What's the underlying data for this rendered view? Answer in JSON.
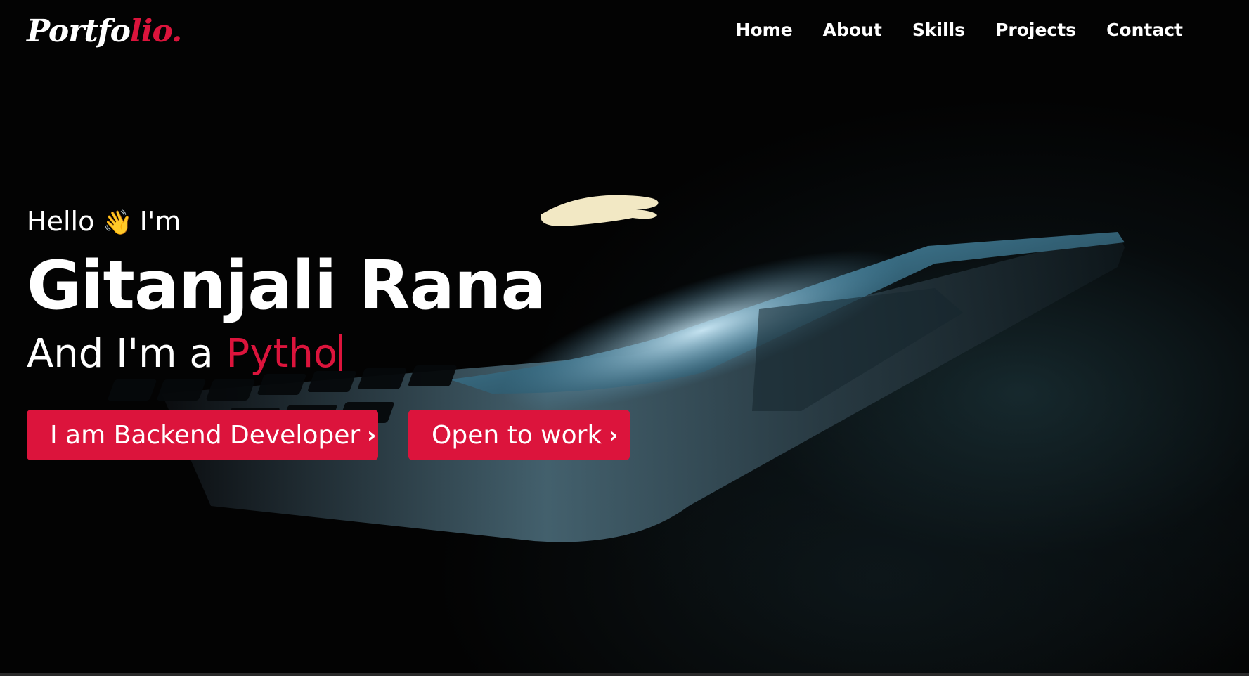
{
  "logo": {
    "main": "Portfo",
    "accent": "lio."
  },
  "nav": {
    "items": [
      "Home",
      "About",
      "Skills",
      "Projects",
      "Contact"
    ]
  },
  "hero": {
    "greeting_prefix": "Hello",
    "wave_emoji": "👋",
    "greeting_suffix": "I'm",
    "name": "Gitanjali Rana",
    "role_prefix": "And I'm a",
    "role_typed": "Pytho"
  },
  "buttons": {
    "primary": "I am Backend Developer",
    "secondary": "Open to work",
    "chevron_icon": "›"
  },
  "colors": {
    "accent": "#dc143c",
    "background": "#030303",
    "text": "#ffffff"
  }
}
